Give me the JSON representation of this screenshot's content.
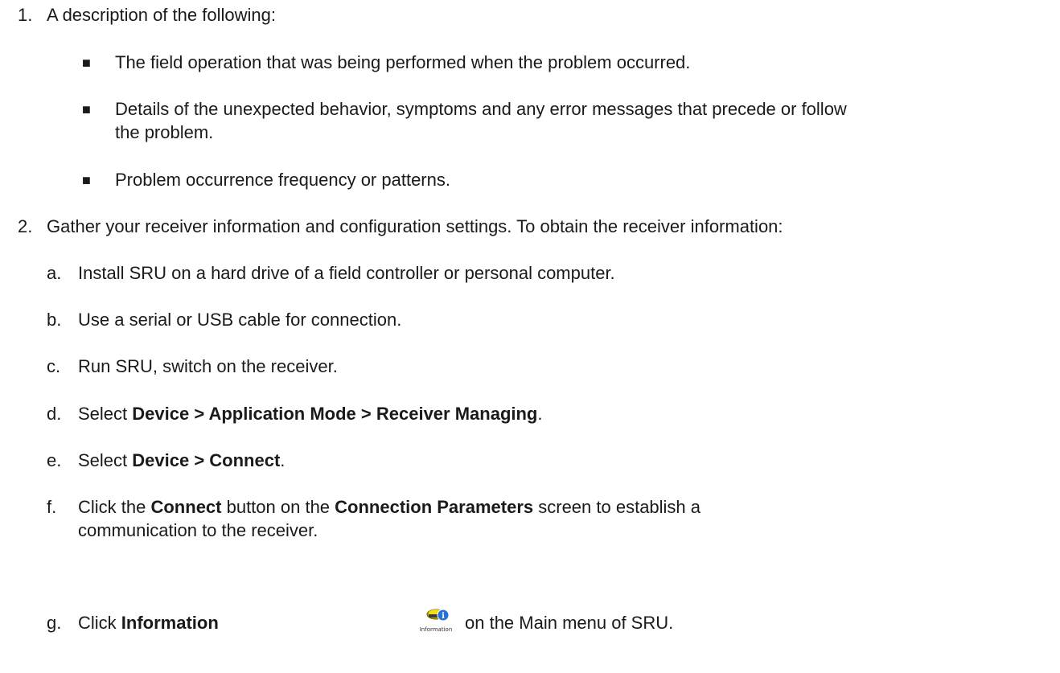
{
  "items": [
    {
      "num": "1.",
      "text": "A description of the following:",
      "bullets": [
        {
          "marker": "■",
          "text": "The field operation that was being performed when the problem occurred."
        },
        {
          "marker": "■",
          "line1": "Details of the unexpected behavior, symptoms and any error messages that precede or follow",
          "line2": "the problem."
        },
        {
          "marker": "■",
          "text": "Problem occurrence frequency or patterns."
        }
      ]
    },
    {
      "num": "2.",
      "text": "Gather your receiver information and configuration settings. To obtain the receiver information:",
      "steps": [
        {
          "marker": "a.",
          "text": "Install SRU on a hard drive of a field controller or personal computer."
        },
        {
          "marker": "b.",
          "text": "Use a serial or USB cable for connection."
        },
        {
          "marker": "c.",
          "text": "Run SRU, switch on the receiver."
        },
        {
          "marker": "d.",
          "pre": "Select ",
          "bold": "Device > Application Mode > Receiver Managing",
          "post": "."
        },
        {
          "marker": "e.",
          "pre": "Select ",
          "bold": "Device > Connect",
          "post": "."
        },
        {
          "marker": "f.",
          "pre": "Click the ",
          "bold1": "Connect",
          "mid": " button on the ",
          "bold2": "Connection Parameters",
          "post": " screen to establish a",
          "line2": "communication to the receiver."
        },
        {
          "marker": "g.",
          "pre": "Click ",
          "bold": "Information",
          "icon_label": "Information",
          "post": " on the Main menu of SRU."
        }
      ]
    }
  ]
}
